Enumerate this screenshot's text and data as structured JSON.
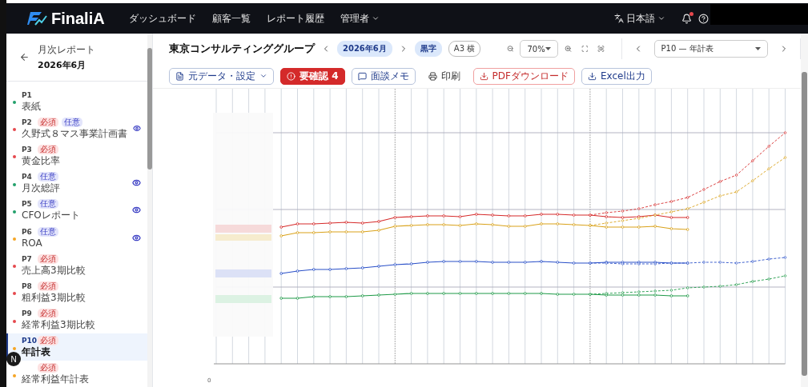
{
  "header": {
    "logo": "FinaliA",
    "nav": [
      {
        "label": "ダッシュボード",
        "dropdown": false
      },
      {
        "label": "顧客一覧",
        "dropdown": false
      },
      {
        "label": "レポート履歴",
        "dropdown": false
      },
      {
        "label": "管理者",
        "dropdown": true
      }
    ],
    "language": "日本語",
    "notification_dot": true
  },
  "sidebar": {
    "title": "月次レポート",
    "period": "2026年6月",
    "items": [
      {
        "page": "P1",
        "title": "表紙",
        "color": "#22a06b",
        "preview": false,
        "selected": false
      },
      {
        "page": "P2",
        "title": "久野式８マス事業計画書",
        "color": "#e5484d",
        "tags": [
          {
            "kind": "required",
            "label": "必須"
          },
          {
            "kind": "optional",
            "label": "任意"
          }
        ],
        "preview": true,
        "selected": false
      },
      {
        "page": "P3",
        "title": "黄金比率",
        "color": "#e5484d",
        "tags": [
          {
            "kind": "required",
            "label": "必須"
          }
        ],
        "preview": false,
        "selected": false
      },
      {
        "page": "P4",
        "title": "月次総評",
        "color": "#22a06b",
        "tags": [
          {
            "kind": "optional",
            "label": "任意"
          }
        ],
        "preview": true,
        "selected": false
      },
      {
        "page": "P5",
        "title": "CFOレポート",
        "color": "#22a06b",
        "tags": [
          {
            "kind": "optional",
            "label": "任意"
          }
        ],
        "preview": true,
        "selected": false
      },
      {
        "page": "P6",
        "title": "ROA",
        "color": "#f5a524",
        "tags": [
          {
            "kind": "optional",
            "label": "任意"
          }
        ],
        "preview": true,
        "selected": false
      },
      {
        "page": "P7",
        "title": "売上高3期比較",
        "color": "#e5484d",
        "tags": [
          {
            "kind": "required",
            "label": "必須"
          }
        ],
        "preview": false,
        "selected": false
      },
      {
        "page": "P8",
        "title": "粗利益3期比較",
        "color": "#e5484d",
        "tags": [
          {
            "kind": "required",
            "label": "必須"
          }
        ],
        "preview": false,
        "selected": false
      },
      {
        "page": "P9",
        "title": "経常利益3期比較",
        "color": "#e5484d",
        "tags": [
          {
            "kind": "required",
            "label": "必須"
          }
        ],
        "preview": false,
        "selected": false
      },
      {
        "page": "P10",
        "title": "年計表",
        "color": "#f5a524",
        "tags": [
          {
            "kind": "required",
            "label": "必須"
          }
        ],
        "preview": false,
        "selected": true
      },
      {
        "title": "経常利益年計表",
        "color": "#f5a524",
        "tags": [
          {
            "kind": "required",
            "label": "必須"
          }
        ],
        "preview": false,
        "selected": false
      }
    ]
  },
  "dev_badge": "N",
  "toolbar": {
    "company": "東京コンサルティンググループ",
    "period": "2026年6月",
    "status": "黒字",
    "paper": "A3 横",
    "zoom": "70%",
    "page_select": "P10 — 年計表"
  },
  "actions": [
    {
      "kind": "dropdown",
      "label": "元データ・設定"
    },
    {
      "kind": "alert",
      "label": "要確認 4"
    },
    {
      "kind": "memo",
      "label": "面談メモ"
    },
    {
      "kind": "print",
      "label": "印刷"
    },
    {
      "kind": "pdf",
      "label": "PDFダウンロード"
    },
    {
      "kind": "excel",
      "label": "Excel出力"
    }
  ],
  "chart": {
    "zero_label": "0"
  }
}
